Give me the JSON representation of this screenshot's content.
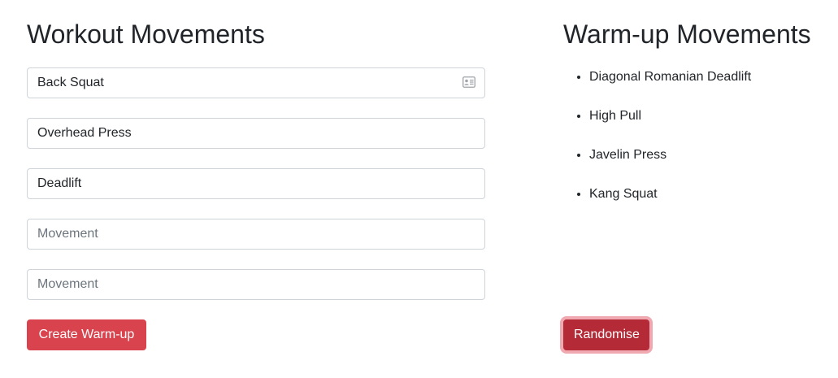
{
  "workout": {
    "heading": "Workout Movements",
    "fields": [
      {
        "value": "Back Squat",
        "placeholder": "Movement"
      },
      {
        "value": "Overhead Press",
        "placeholder": "Movement"
      },
      {
        "value": "Deadlift",
        "placeholder": "Movement"
      },
      {
        "value": "",
        "placeholder": "Movement"
      },
      {
        "value": "",
        "placeholder": "Movement"
      }
    ],
    "create_button": "Create Warm-up"
  },
  "warmup": {
    "heading": "Warm-up Movements",
    "items": [
      "Diagonal Romanian Deadlift",
      "High Pull",
      "Javelin Press",
      "Kang Squat"
    ],
    "randomise_button": "Randomise"
  },
  "colors": {
    "primary_button": "#d9434e",
    "randomise_button_active": "#b52a37",
    "focus_ring": "#e15361"
  },
  "icons": {
    "autofill": "contact-card-icon"
  }
}
